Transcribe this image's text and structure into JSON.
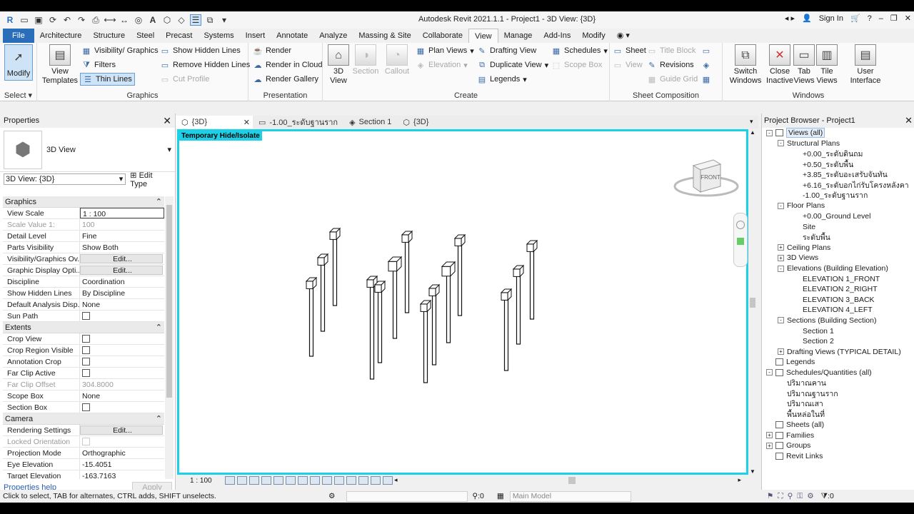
{
  "window": {
    "title": "Autodesk Revit 2021.1.1 - Project1 - 3D View: {3D}",
    "sign_in": "Sign In",
    "help": "?"
  },
  "ribbon_tabs": [
    "File",
    "Architecture",
    "Structure",
    "Steel",
    "Precast",
    "Systems",
    "Insert",
    "Annotate",
    "Analyze",
    "Massing & Site",
    "Collaborate",
    "View",
    "Manage",
    "Add-Ins",
    "Modify"
  ],
  "ribbon": {
    "select": {
      "modify": "Modify",
      "title": "Select"
    },
    "graphics": {
      "title": "Graphics",
      "view_templates": "View Templates",
      "visibility": "Visibility/ Graphics",
      "filters": "Filters",
      "thin_lines": "Thin Lines",
      "show_hidden": "Show Hidden Lines",
      "remove_hidden": "Remove Hidden Lines",
      "cut_profile": "Cut Profile"
    },
    "presentation": {
      "title": "Presentation",
      "render": "Render",
      "render_cloud": "Render in Cloud",
      "render_gallery": "Render Gallery"
    },
    "create": {
      "title": "Create",
      "view3d": "3D View",
      "section": "Section",
      "callout": "Callout",
      "plan_views": "Plan Views",
      "elevation": "Elevation",
      "drafting_view": "Drafting View",
      "duplicate_view": "Duplicate View",
      "legends": "Legends",
      "schedules": "Schedules",
      "scope_box": "Scope Box"
    },
    "sheet_composition": {
      "title": "Sheet Composition",
      "sheet": "Sheet",
      "view": "View",
      "title_block": "Title Block",
      "revisions": "Revisions",
      "guide_grid": "Guide Grid"
    },
    "windows": {
      "title": "Windows",
      "switch": "Switch Windows",
      "close_inactive": "Close Inactive",
      "tab_views": "Tab Views",
      "tile_views": "Tile Views",
      "user_interface": "User Interface"
    }
  },
  "properties": {
    "title": "Properties",
    "type_name": "3D View",
    "selector": "3D View: {3D}",
    "edit_type": "Edit Type",
    "groups": [
      {
        "name": "Graphics",
        "rows": [
          {
            "name": "View Scale",
            "value": "1 : 100",
            "kind": "box"
          },
          {
            "name": "Scale Value    1:",
            "value": "100",
            "kind": "dis"
          },
          {
            "name": "Detail Level",
            "value": "Fine"
          },
          {
            "name": "Parts Visibility",
            "value": "Show Both"
          },
          {
            "name": "Visibility/Graphics Ov...",
            "value": "Edit...",
            "kind": "btn"
          },
          {
            "name": "Graphic Display Opti...",
            "value": "Edit...",
            "kind": "btn"
          },
          {
            "name": "Discipline",
            "value": "Coordination"
          },
          {
            "name": "Show Hidden Lines",
            "value": "By Discipline"
          },
          {
            "name": "Default Analysis Disp...",
            "value": "None"
          },
          {
            "name": "Sun Path",
            "value": "",
            "kind": "chk"
          }
        ]
      },
      {
        "name": "Extents",
        "rows": [
          {
            "name": "Crop View",
            "value": "",
            "kind": "chk"
          },
          {
            "name": "Crop Region Visible",
            "value": "",
            "kind": "chk"
          },
          {
            "name": "Annotation Crop",
            "value": "",
            "kind": "chk"
          },
          {
            "name": "Far Clip Active",
            "value": "",
            "kind": "chk"
          },
          {
            "name": "Far Clip Offset",
            "value": "304.8000",
            "kind": "dis"
          },
          {
            "name": "Scope Box",
            "value": "None"
          },
          {
            "name": "Section Box",
            "value": "",
            "kind": "chk"
          }
        ]
      },
      {
        "name": "Camera",
        "rows": [
          {
            "name": "Rendering Settings",
            "value": "Edit...",
            "kind": "btn"
          },
          {
            "name": "Locked Orientation",
            "value": "",
            "kind": "chkdis"
          },
          {
            "name": "Projection Mode",
            "value": "Orthographic"
          },
          {
            "name": "Eye Elevation",
            "value": "-15.4051"
          },
          {
            "name": "Target Elevation",
            "value": "-163.7163"
          }
        ]
      }
    ],
    "help": "Properties help",
    "apply": "Apply"
  },
  "view_tabs": [
    {
      "label": "{3D}",
      "active": true
    },
    {
      "label": "-1.00_ระดับฐานราก"
    },
    {
      "label": "Section 1"
    },
    {
      "label": "{3D}"
    }
  ],
  "canvas": {
    "temp_tag": "Temporary Hide/Isolate",
    "viewcube": "FRONT",
    "scale": "1 : 100"
  },
  "browser": {
    "title": "Project Browser - Project1",
    "items": [
      {
        "label": "Views (all)",
        "lvl": 0,
        "tog": "-",
        "icon": true,
        "hl": true
      },
      {
        "label": "Structural Plans",
        "lvl": 1,
        "tog": "-"
      },
      {
        "label": "+0.00_ระดับดินถม",
        "lvl": 2
      },
      {
        "label": "+0.50_ระดับพื้น",
        "lvl": 2
      },
      {
        "label": "+3.85_ระดับอะเสรับจันทัน",
        "lvl": 2
      },
      {
        "label": "+6.16_ระดับอกไก่รับโครงหลังคา",
        "lvl": 2
      },
      {
        "label": "-1.00_ระดับฐานราก",
        "lvl": 2
      },
      {
        "label": "Floor Plans",
        "lvl": 1,
        "tog": "-"
      },
      {
        "label": "+0.00_Ground Level",
        "lvl": 2
      },
      {
        "label": "Site",
        "lvl": 2
      },
      {
        "label": "ระดับพื้น",
        "lvl": 2
      },
      {
        "label": "Ceiling Plans",
        "lvl": 1,
        "tog": "+"
      },
      {
        "label": "3D Views",
        "lvl": 1,
        "tog": "+"
      },
      {
        "label": "Elevations (Building Elevation)",
        "lvl": 1,
        "tog": "-"
      },
      {
        "label": "ELEVATION 1_FRONT",
        "lvl": 2
      },
      {
        "label": "ELEVATION 2_RIGHT",
        "lvl": 2
      },
      {
        "label": "ELEVATION 3_BACK",
        "lvl": 2
      },
      {
        "label": "ELEVATION 4_LEFT",
        "lvl": 2
      },
      {
        "label": "Sections (Building Section)",
        "lvl": 1,
        "tog": "-"
      },
      {
        "label": "Section 1",
        "lvl": 2
      },
      {
        "label": "Section 2",
        "lvl": 2
      },
      {
        "label": "Drafting Views (TYPICAL DETAIL)",
        "lvl": 1,
        "tog": "+"
      },
      {
        "label": "Legends",
        "lvl": 0,
        "icon": true
      },
      {
        "label": "Schedules/Quantities (all)",
        "lvl": 0,
        "tog": "-",
        "icon": true
      },
      {
        "label": "ปริมาณคาน",
        "lvl": 1
      },
      {
        "label": "ปริมาณฐานราก",
        "lvl": 1
      },
      {
        "label": "ปริมาณเสา",
        "lvl": 1
      },
      {
        "label": "พื้นหล่อในที่",
        "lvl": 1
      },
      {
        "label": "Sheets (all)",
        "lvl": 0,
        "icon": true
      },
      {
        "label": "Families",
        "lvl": 0,
        "tog": "+",
        "icon": true
      },
      {
        "label": "Groups",
        "lvl": 0,
        "tog": "+",
        "icon": true
      },
      {
        "label": "Revit Links",
        "lvl": 0,
        "icon": true
      }
    ]
  },
  "status": {
    "hint": "Click to select, TAB for alternates, CTRL adds, SHIFT unselects.",
    "count": ":0",
    "model": "Main Model",
    "filter_count": ":0"
  }
}
